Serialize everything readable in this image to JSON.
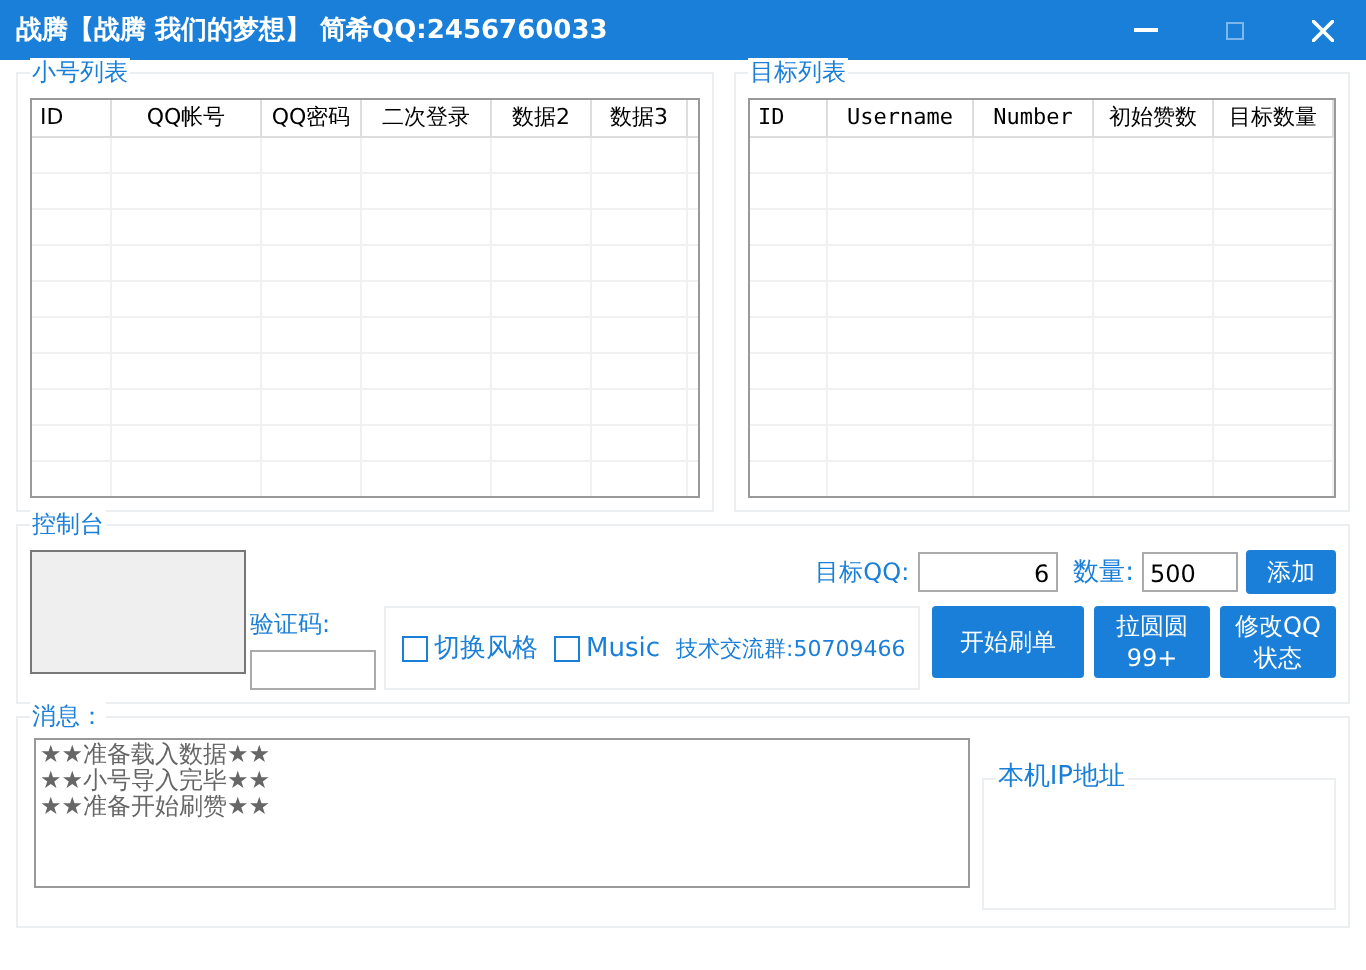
{
  "window": {
    "title": "战腾【战腾 我们的梦想】 简希QQ:2456760033"
  },
  "account_list": {
    "title": "小号列表",
    "columns": [
      "ID",
      "QQ帐号",
      "QQ密码",
      "二次登录",
      "数据2",
      "数据3"
    ]
  },
  "target_list": {
    "title": "目标列表",
    "columns": [
      "ID",
      "Username",
      "Number",
      "初始赞数",
      "目标数量"
    ]
  },
  "console": {
    "title": "控制台",
    "captcha_label": "验证码:",
    "options": [
      {
        "label": "切换风格",
        "checked": false
      },
      {
        "label": "Music",
        "checked": false
      }
    ],
    "group_text": "技术交流群:50709466",
    "target_qq_label": "目标QQ:",
    "target_qq_value": "6",
    "quantity_label": "数量:",
    "quantity_value": "500",
    "add_button": "添加",
    "buttons": [
      "开始刷单",
      "拉圆圆99+",
      "修改QQ状态"
    ]
  },
  "messages": {
    "title": "消息：",
    "lines": [
      "★★准备载入数据★★",
      "★★小号导入完毕★★",
      "★★准备开始刷赞★★"
    ]
  },
  "ip_panel": {
    "title": "本机IP地址"
  }
}
